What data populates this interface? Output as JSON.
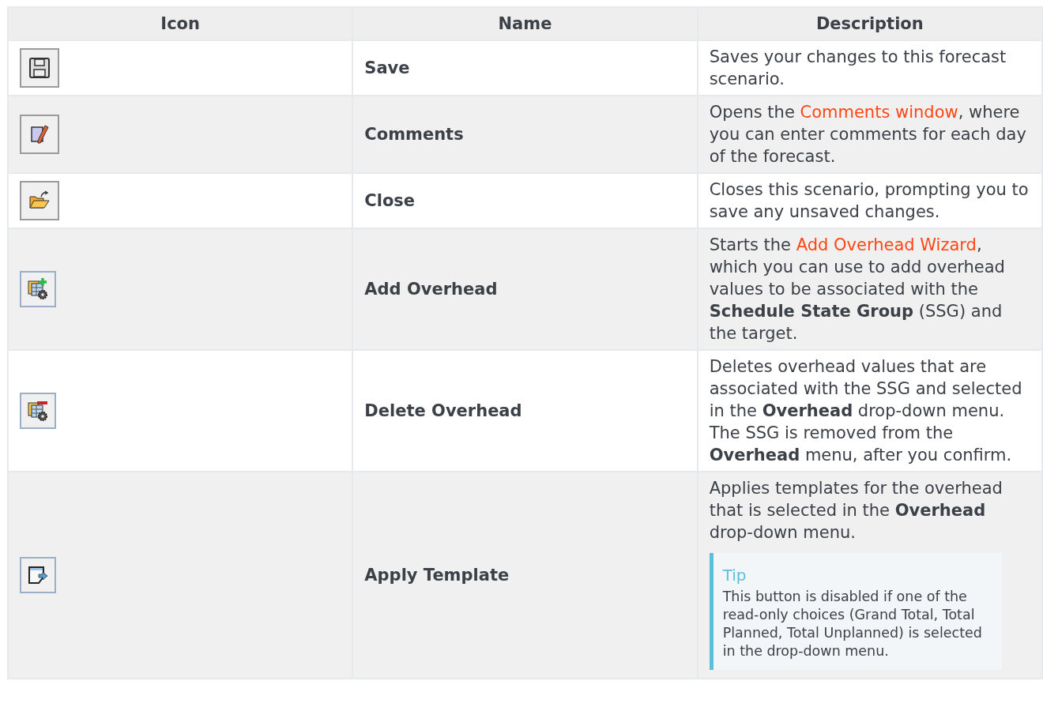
{
  "table": {
    "columns": [
      "Icon",
      "Name",
      "Description"
    ],
    "rows": [
      {
        "kind": "save",
        "name": "Save",
        "description": [
          {
            "kind": "text",
            "text": "Saves your changes to this forecast scenario."
          }
        ]
      },
      {
        "kind": "comments",
        "name": "Comments",
        "description": [
          {
            "kind": "text",
            "text": "Opens the "
          },
          {
            "kind": "link",
            "text": "Comments window"
          },
          {
            "kind": "text",
            "text": ", where you can enter comments for each day of the forecast."
          }
        ]
      },
      {
        "kind": "close",
        "name": "Close",
        "description": [
          {
            "kind": "text",
            "text": "Closes this scenario, prompting you to save any unsaved changes."
          }
        ]
      },
      {
        "kind": "add-overhead",
        "name": "Add Overhead",
        "description": [
          {
            "kind": "text",
            "text": "Starts the "
          },
          {
            "kind": "link",
            "text": "Add Overhead Wizard"
          },
          {
            "kind": "text",
            "text": ", which you can use to add overhead values to be associated with the **Schedule State Group** (SSG) and the target."
          }
        ]
      },
      {
        "kind": "delete-overhead",
        "name": "Delete Overhead",
        "description": [
          {
            "kind": "text",
            "text": "Deletes overhead values that are associated with the SSG and selected in the **Overhead** drop-down menu. The SSG is removed from the **Overhead** menu, after you confirm."
          }
        ]
      },
      {
        "kind": "apply-template",
        "name": "Apply Template",
        "description": [
          {
            "kind": "text",
            "text": "Applies templates for the overhead that is selected in the **Overhead** drop-down menu."
          }
        ],
        "tip": {
          "title": "Tip",
          "text": "This button is disabled if one of the read-only choices (Grand Total, Total Planned, Total Unplanned) is selected in the drop-down menu."
        }
      }
    ]
  }
}
